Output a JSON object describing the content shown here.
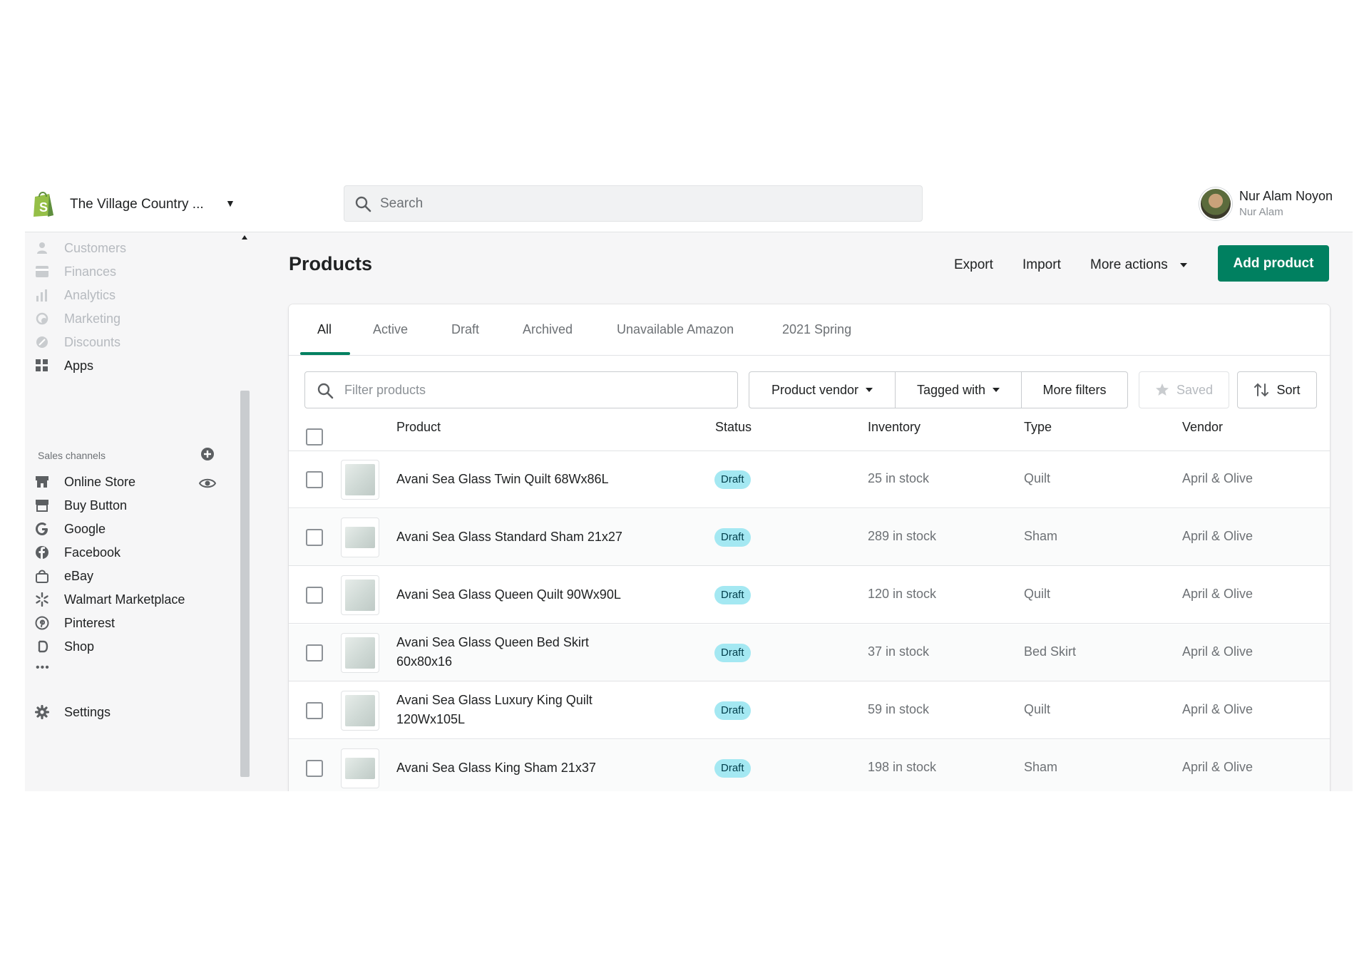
{
  "topbar": {
    "store_name": "The Village Country ...",
    "search_placeholder": "Search",
    "user_name": "Nur Alam Noyon",
    "user_sub": "Nur Alam"
  },
  "sidebar": {
    "items_top": [
      {
        "label": "Customers",
        "icon": "person-icon"
      },
      {
        "label": "Finances",
        "icon": "finance-icon"
      },
      {
        "label": "Analytics",
        "icon": "bar-chart-icon"
      },
      {
        "label": "Marketing",
        "icon": "marketing-icon"
      },
      {
        "label": "Discounts",
        "icon": "discount-icon"
      },
      {
        "label": "Apps",
        "icon": "apps-icon"
      }
    ],
    "sales_channels_title": "Sales channels",
    "channels": [
      {
        "label": "Online Store",
        "icon": "store-icon"
      },
      {
        "label": "Buy Button",
        "icon": "buy-button-icon"
      },
      {
        "label": "Google",
        "icon": "google-icon"
      },
      {
        "label": "Facebook",
        "icon": "facebook-icon"
      },
      {
        "label": "eBay",
        "icon": "ebay-icon"
      },
      {
        "label": "Walmart Marketplace",
        "icon": "walmart-icon"
      },
      {
        "label": "Pinterest",
        "icon": "pinterest-icon"
      },
      {
        "label": "Shop",
        "icon": "shop-icon"
      }
    ],
    "more": "•••",
    "settings_label": "Settings"
  },
  "main": {
    "title": "Products",
    "export_label": "Export",
    "import_label": "Import",
    "more_actions_label": "More actions",
    "add_product_label": "Add product",
    "tabs": [
      "All",
      "Active",
      "Draft",
      "Archived",
      "Unavailable Amazon",
      "2021 Spring"
    ],
    "filter_placeholder": "Filter products",
    "product_vendor_label": "Product vendor",
    "tagged_with_label": "Tagged with",
    "more_filters_label": "More filters",
    "saved_label": "Saved",
    "sort_label": "Sort",
    "columns": {
      "product": "Product",
      "status": "Status",
      "inventory": "Inventory",
      "type": "Type",
      "vendor": "Vendor"
    },
    "rows": [
      {
        "name": "Avani Sea Glass Twin Quilt 68Wx86L",
        "status": "Draft",
        "inventory": "25 in stock",
        "type": "Quilt",
        "vendor": "April & Olive"
      },
      {
        "name": "Avani Sea Glass Standard Sham 21x27",
        "status": "Draft",
        "inventory": "289 in stock",
        "type": "Sham",
        "vendor": "April & Olive"
      },
      {
        "name": "Avani Sea Glass Queen Quilt 90Wx90L",
        "status": "Draft",
        "inventory": "120 in stock",
        "type": "Quilt",
        "vendor": "April & Olive"
      },
      {
        "name": "Avani Sea Glass Queen Bed Skirt 60x80x16",
        "status": "Draft",
        "inventory": "37 in stock",
        "type": "Bed Skirt",
        "vendor": "April & Olive"
      },
      {
        "name": "Avani Sea Glass Luxury King Quilt 120Wx105L",
        "status": "Draft",
        "inventory": "59 in stock",
        "type": "Quilt",
        "vendor": "April & Olive"
      },
      {
        "name": "Avani Sea Glass King Sham 21x37",
        "status": "Draft",
        "inventory": "198 in stock",
        "type": "Sham",
        "vendor": "April & Olive"
      }
    ]
  },
  "colors": {
    "accent": "#008060",
    "badge_bg": "#a4e8f2",
    "badge_text": "#003d4a"
  }
}
